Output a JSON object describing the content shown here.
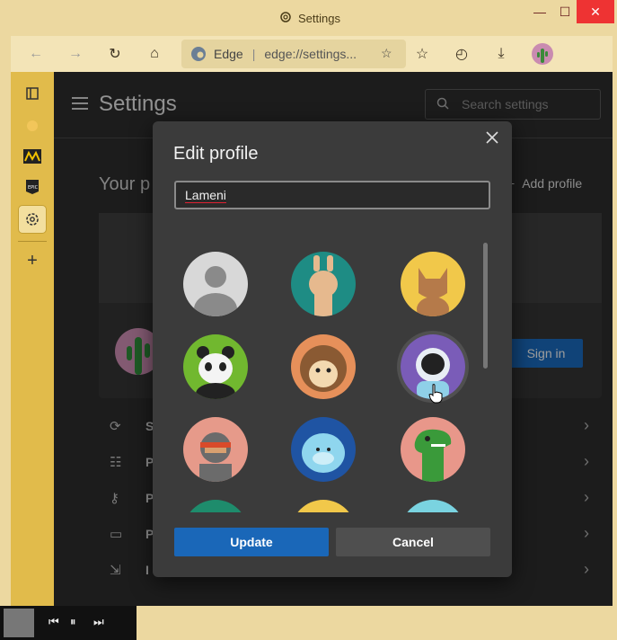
{
  "window": {
    "title": "Settings"
  },
  "toolbar": {
    "address_brand": "Edge",
    "address_url": "edge://settings..."
  },
  "settings": {
    "title": "Settings",
    "search_placeholder": "Search settings",
    "your_profile": "Your p",
    "add_profile": "Add profile",
    "sign_in": "Sign in",
    "rows": [
      {
        "label": "S",
        "icon": "sync-icon"
      },
      {
        "label": "P",
        "icon": "personal-info-icon"
      },
      {
        "label": "P",
        "icon": "key-icon"
      },
      {
        "label": "P",
        "icon": "card-icon"
      },
      {
        "label": "I",
        "icon": "import-icon"
      }
    ]
  },
  "dialog": {
    "title": "Edit profile",
    "name_value": "Lameni",
    "update_label": "Update",
    "cancel_label": "Cancel",
    "avatars": [
      "default-avatar",
      "llama-avatar",
      "cat-avatar",
      "panda-avatar",
      "hedgehog-avatar",
      "astronaut-avatar",
      "ninja-avatar",
      "yeti-avatar",
      "dinosaur-avatar"
    ],
    "selected_avatar": "astronaut-avatar"
  },
  "colors": {
    "accent": "#1a67b8",
    "frame": "#ecd8a0",
    "sidebar": "#e1bb4b",
    "dialog": "#3b3b3b"
  }
}
